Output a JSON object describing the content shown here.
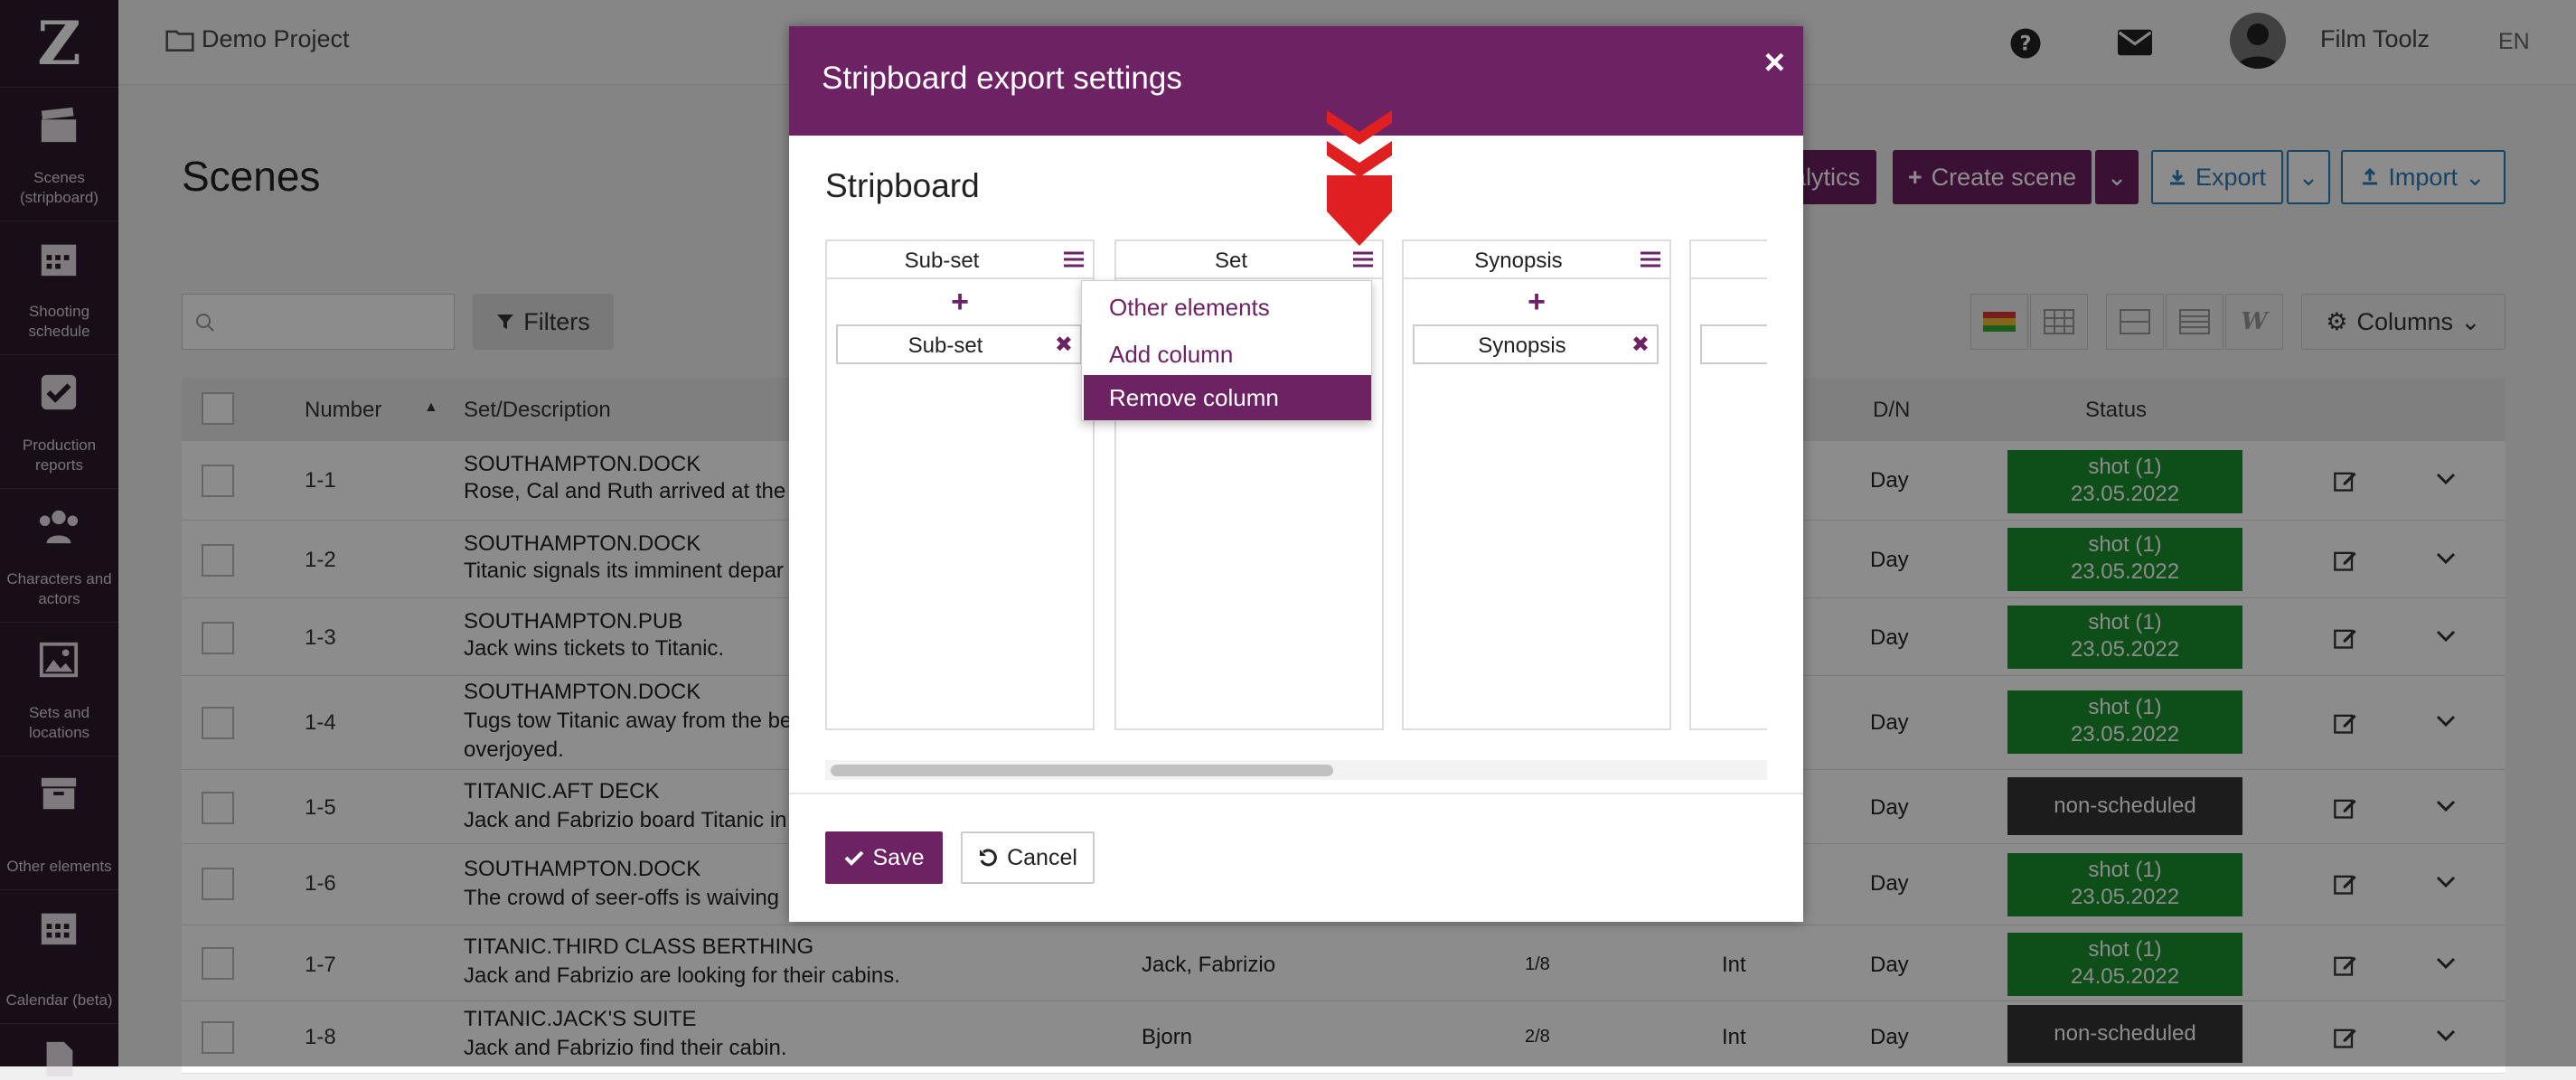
{
  "sidebar": {
    "logo": "Z",
    "items": [
      {
        "label": "Scenes (stripboard)",
        "icon": "clapperboard-icon"
      },
      {
        "label": "Shooting schedule",
        "icon": "calendar-icon"
      },
      {
        "label": "Production reports",
        "icon": "checkbox-icon"
      },
      {
        "label": "Characters and actors",
        "icon": "people-icon"
      },
      {
        "label": "Sets and locations",
        "icon": "image-icon"
      },
      {
        "label": "Other elements",
        "icon": "archive-icon"
      },
      {
        "label": "Calendar (beta)",
        "icon": "calendar-grid-icon"
      }
    ]
  },
  "topbar": {
    "project": "Demo Project",
    "user": "Film Toolz",
    "lang": "EN"
  },
  "page": {
    "title": "Scenes",
    "analytics_label": "alytics",
    "create_label": "Create scene",
    "export_label": "Export",
    "import_label": "Import",
    "filters_label": "Filters",
    "columns_label": "Columns",
    "w_label": "W"
  },
  "table": {
    "headers": {
      "number": "Number",
      "set": "Set/Description",
      "dn": "D/N",
      "status": "Status"
    },
    "rows": [
      {
        "num": "1-1",
        "set": "SOUTHAMPTON.DOCK",
        "desc": "Rose, Cal and Ruth arrived at the b",
        "cast": "",
        "pages": "",
        "ie": "",
        "dn": "Day",
        "status": "shot (1)",
        "date": "23.05.2022"
      },
      {
        "num": "1-2",
        "set": "SOUTHAMPTON.DOCK",
        "desc": "Titanic signals its imminent depar",
        "cast": "",
        "pages": "",
        "ie": "",
        "dn": "Day",
        "status": "shot (1)",
        "date": "23.05.2022"
      },
      {
        "num": "1-3",
        "set": "SOUTHAMPTON.PUB",
        "desc": "Jack wins tickets to Titanic.",
        "cast": "",
        "pages": "",
        "ie": "",
        "dn": "Day",
        "status": "shot (1)",
        "date": "23.05.2022"
      },
      {
        "num": "1-4",
        "set": "SOUTHAMPTON.DOCK",
        "desc": "Tugs tow Titanic away from the be",
        "desc2": "overjoyed.",
        "cast": "",
        "pages": "",
        "ie": "",
        "dn": "Day",
        "status": "shot (1)",
        "date": "23.05.2022"
      },
      {
        "num": "1-5",
        "set": "TITANIC.AFT DECK",
        "desc": "Jack and Fabrizio board Titanic in",
        "cast": "",
        "pages": "",
        "ie": "",
        "dn": "Day",
        "status": "non-scheduled",
        "date": ""
      },
      {
        "num": "1-6",
        "set": "SOUTHAMPTON.DOCK",
        "desc": "The crowd of seer-offs is waiving",
        "cast": "",
        "pages": "",
        "ie": "",
        "dn": "Day",
        "status": "shot (1)",
        "date": "23.05.2022"
      },
      {
        "num": "1-7",
        "set": "TITANIC.THIRD CLASS BERTHING",
        "desc": "Jack and Fabrizio are looking for their cabins.",
        "cast": "Jack, Fabrizio",
        "pages": "1/8",
        "ie": "Int",
        "dn": "Day",
        "status": "shot (1)",
        "date": "24.05.2022"
      },
      {
        "num": "1-8",
        "set": "TITANIC.JACK'S SUITE",
        "desc": "Jack and Fabrizio find their cabin.",
        "cast": "Bjorn",
        "pages": "2/8",
        "ie": "Int",
        "dn": "Day",
        "status": "non-scheduled",
        "date": ""
      }
    ]
  },
  "modal": {
    "title": "Stripboard export settings",
    "close": "×",
    "section_title": "Stripboard",
    "columns": [
      {
        "title": "Sub-set",
        "add": "+",
        "chip": "Sub-set",
        "chip_x": "✖"
      },
      {
        "title": "Set",
        "add": "+",
        "chip": "",
        "chip_x": ""
      },
      {
        "title": "Synopsis",
        "add": "+",
        "chip": "Synopsis",
        "chip_x": "✖"
      },
      {
        "title": "",
        "add": "",
        "chip": "",
        "chip_x": ""
      }
    ],
    "dropdown": [
      "Other elements",
      "Add column",
      "Remove column"
    ],
    "save_label": "Save",
    "cancel_label": "Cancel"
  },
  "colors": {
    "accent": "#6d2264",
    "shot": "#1a8f2e",
    "nonscheduled": "#333333",
    "arrow": "#e02020"
  }
}
